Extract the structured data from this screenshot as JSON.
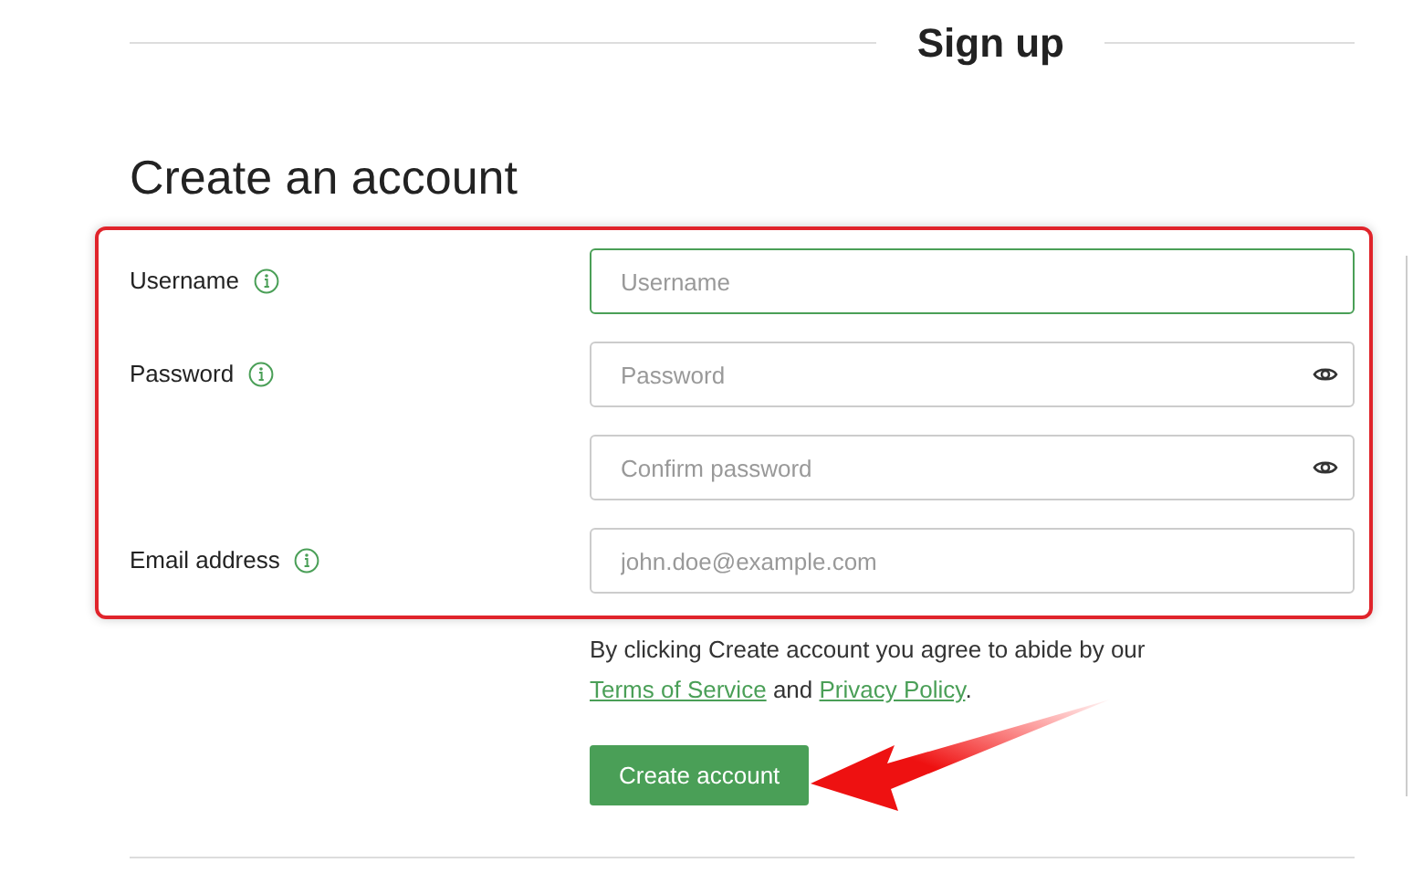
{
  "header": {
    "title": "Sign up"
  },
  "form": {
    "title": "Create an account",
    "fields": [
      {
        "label": "Username",
        "placeholder": "Username",
        "focused": true,
        "kind": "text"
      },
      {
        "label": "Password",
        "placeholder": "Password",
        "focused": false,
        "kind": "password"
      },
      {
        "placeholder": "Confirm password",
        "focused": false,
        "kind": "password"
      },
      {
        "label": "Email address",
        "placeholder": "john.doe@example.com",
        "focused": false,
        "kind": "text"
      }
    ],
    "agreement": {
      "before": "By clicking Create account you agree to abide by our",
      "link1": "Terms of Service",
      "middle": "and",
      "link2": "Privacy Policy",
      "after": "."
    },
    "submit": "Create account"
  }
}
